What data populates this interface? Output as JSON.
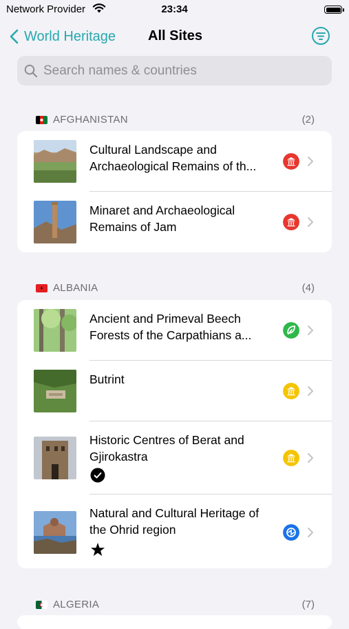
{
  "status_bar": {
    "carrier": "Network Provider",
    "time": "23:34"
  },
  "nav": {
    "back_label": "World Heritage",
    "title": "All Sites"
  },
  "search": {
    "placeholder": "Search names & countries",
    "value": ""
  },
  "colors": {
    "accent": "#27a8ad",
    "cultural": "#e8372f",
    "cultural_yellow": "#f5c400",
    "natural": "#2fb84a",
    "mixed": "#1a73e8"
  },
  "sections": [
    {
      "country": "AFGHANISTAN",
      "count": "(2)",
      "sites": [
        {
          "name": "Cultural Landscape and Archaeological Remains of th...",
          "badge": "cultural-red-icon",
          "mark": ""
        },
        {
          "name": "Minaret and Archaeological Remains of Jam",
          "badge": "cultural-red-icon",
          "mark": ""
        }
      ]
    },
    {
      "country": "ALBANIA",
      "count": "(4)",
      "sites": [
        {
          "name": "Ancient and Primeval Beech Forests of the Carpathians a...",
          "badge": "natural-green-icon",
          "mark": ""
        },
        {
          "name": "Butrint",
          "badge": "cultural-yellow-icon",
          "mark": ""
        },
        {
          "name": "Historic Centres of Berat and Gjirokastra",
          "badge": "cultural-yellow-icon",
          "mark": "visited-check-icon"
        },
        {
          "name": "Natural and Cultural Heritage of the Ohrid region",
          "badge": "mixed-blue-icon",
          "mark": "star-icon"
        }
      ]
    },
    {
      "country": "ALGERIA",
      "count": "(7)",
      "sites": []
    }
  ]
}
